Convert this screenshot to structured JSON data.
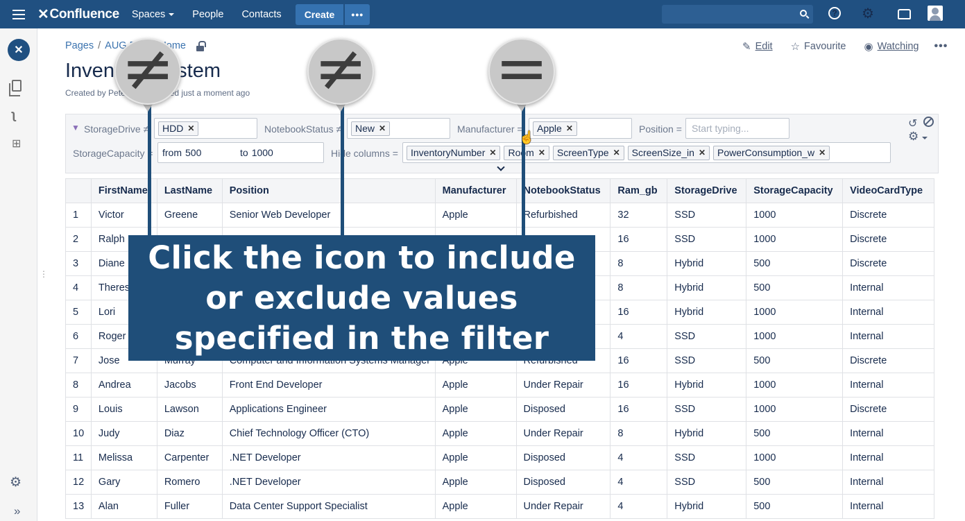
{
  "topnav": {
    "logo": "Confluence",
    "spaces": "Spaces",
    "people": "People",
    "contacts": "Contacts",
    "create": "Create",
    "more": "•••",
    "search_value": ""
  },
  "page": {
    "breadcrumb": [
      "Pages",
      "AUG Demo Home"
    ],
    "breadcrumb_sep": "/",
    "title": "Inventory System",
    "byline": "Created by Peter, last modified just a moment ago",
    "actions": {
      "edit": "Edit",
      "favourite": "Favourite",
      "watching": "Watching"
    }
  },
  "filters": {
    "storage_drive": {
      "label": "StorageDrive ≠",
      "chips": [
        "HDD"
      ]
    },
    "notebook_status": {
      "label": "NotebookStatus ≠",
      "chips": [
        "New"
      ]
    },
    "manufacturer": {
      "label": "Manufacturer =",
      "chips": [
        "Apple"
      ]
    },
    "position": {
      "label": "Position =",
      "placeholder": "Start typing..."
    },
    "storage_capacity": {
      "label": "StorageCapacity =",
      "from_label": "from",
      "from_value": "500",
      "to_label": "to",
      "to_value": "1000"
    },
    "hide_columns": {
      "label": "Hide columns =",
      "chips": [
        "InventoryNumber",
        "Room",
        "ScreenType",
        "ScreenSize_in",
        "PowerConsumption_w"
      ]
    }
  },
  "table": {
    "columns": [
      "",
      "FirstName",
      "LastName",
      "Position",
      "Manufacturer",
      "NotebookStatus",
      "Ram_gb",
      "StorageDrive",
      "StorageCapacity",
      "VideoCardType"
    ],
    "rows": [
      [
        "1",
        "Victor",
        "Greene",
        "Senior Web Developer",
        "Apple",
        "Refurbished",
        "32",
        "SSD",
        "1000",
        "Discrete"
      ],
      [
        "2",
        "Ralph",
        "",
        "",
        "",
        "",
        "16",
        "SSD",
        "1000",
        "Discrete"
      ],
      [
        "3",
        "Diane",
        "",
        "",
        "",
        "",
        "8",
        "Hybrid",
        "500",
        "Discrete"
      ],
      [
        "4",
        "Theresa",
        "",
        "",
        "",
        "",
        "8",
        "Hybrid",
        "500",
        "Internal"
      ],
      [
        "5",
        "Lori",
        "",
        "",
        "",
        "",
        "16",
        "Hybrid",
        "1000",
        "Internal"
      ],
      [
        "6",
        "Roger",
        "",
        "",
        "",
        "",
        "4",
        "SSD",
        "1000",
        "Internal"
      ],
      [
        "7",
        "Jose",
        "Murray",
        "Computer and Information Systems Manager",
        "Apple",
        "Refurbished",
        "16",
        "SSD",
        "500",
        "Discrete"
      ],
      [
        "8",
        "Andrea",
        "Jacobs",
        "Front End Developer",
        "Apple",
        "Under Repair",
        "16",
        "Hybrid",
        "1000",
        "Internal"
      ],
      [
        "9",
        "Louis",
        "Lawson",
        "Applications Engineer",
        "Apple",
        "Disposed",
        "16",
        "SSD",
        "1000",
        "Discrete"
      ],
      [
        "10",
        "Judy",
        "Diaz",
        "Chief Technology Officer (CTO)",
        "Apple",
        "Under Repair",
        "8",
        "Hybrid",
        "500",
        "Internal"
      ],
      [
        "11",
        "Melissa",
        "Carpenter",
        ".NET Developer",
        "Apple",
        "Disposed",
        "4",
        "SSD",
        "1000",
        "Internal"
      ],
      [
        "12",
        "Gary",
        "Romero",
        ".NET Developer",
        "Apple",
        "Disposed",
        "4",
        "SSD",
        "500",
        "Internal"
      ],
      [
        "13",
        "Alan",
        "Fuller",
        "Data Center Support Specialist",
        "Apple",
        "Under Repair",
        "4",
        "Hybrid",
        "500",
        "Internal"
      ]
    ]
  },
  "overlay": {
    "callout_symbols": [
      "≠",
      "≠",
      "="
    ],
    "text": "Click the icon to include or exclude values specified in the filter"
  },
  "colors": {
    "nav": "#205081",
    "overlay": "#1f4e79",
    "link": "#3b73af"
  }
}
